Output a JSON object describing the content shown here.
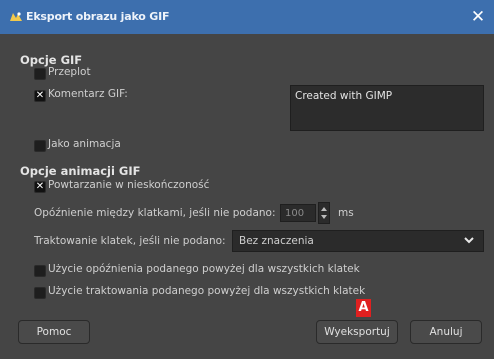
{
  "window": {
    "title": "Eksport obrazu jako GIF",
    "close_glyph": "✕"
  },
  "gif_options": {
    "heading": "Opcje GIF",
    "interlace": {
      "label": "Przeplot",
      "checked": false
    },
    "comment": {
      "label": "Komentarz GIF:",
      "checked": true,
      "value": "Created with GIMP"
    },
    "as_animation": {
      "label": "Jako animacja",
      "checked": false
    }
  },
  "animation_options": {
    "heading": "Opcje animacji GIF",
    "loop_forever": {
      "label": "Powtarzanie w nieskończoność",
      "checked": true
    },
    "delay": {
      "label": "Opóźnienie między klatkami, jeśli nie podano:",
      "value": "100",
      "unit": "ms"
    },
    "disposal": {
      "label": "Traktowanie klatek, jeśli nie podano:",
      "selected": "Bez znaczenia"
    },
    "use_delay_all": {
      "label": "Użycie opóźnienia podanego powyżej dla wszystkich klatek",
      "checked": false
    },
    "use_disposal_all": {
      "label": "Użycie traktowania podanego powyżej dla wszystkich klatek",
      "checked": false
    }
  },
  "buttons": {
    "help": "Pomoc",
    "export": "Wyeksportuj",
    "cancel": "Anuluj"
  },
  "annotation": {
    "badge": "A"
  },
  "colors": {
    "titlebar": "#3d6fae",
    "badge": "#e02020",
    "background": "#454545"
  }
}
